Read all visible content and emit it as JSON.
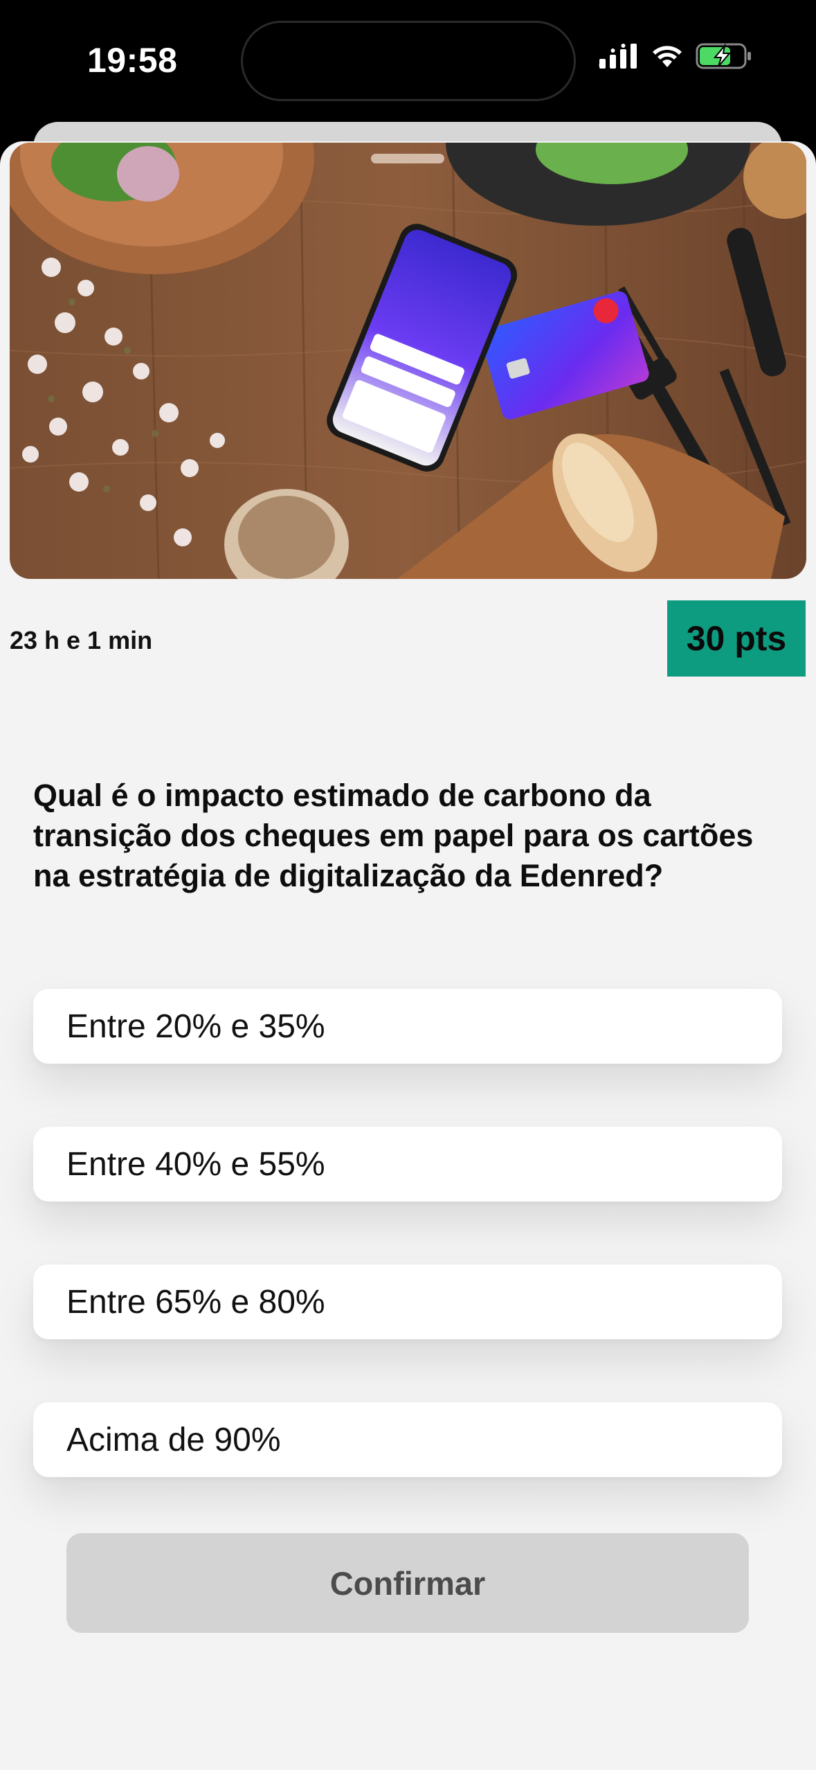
{
  "status_bar": {
    "time": "19:58",
    "icons": [
      "cellular-signal-icon",
      "wifi-icon",
      "battery-charging-icon"
    ]
  },
  "quiz": {
    "time_remaining": "23 h e 1 min",
    "points": "30 pts",
    "question": "Qual é o impacto estimado de carbono da transição dos cheques em papel para os cartões na estratégia de digitalização da Edenred?",
    "options": [
      {
        "label": "Entre 20% e 35%"
      },
      {
        "label": "Entre 40% e 55%"
      },
      {
        "label": "Entre 65% e 80%"
      },
      {
        "label": "Acima de 90%"
      }
    ],
    "confirm_label": "Confirmar"
  },
  "colors": {
    "badge": "#0e9c80",
    "background": "#f3f3f3",
    "confirm_disabled": "#d3d3d3",
    "battery_charging": "#4cd964"
  }
}
